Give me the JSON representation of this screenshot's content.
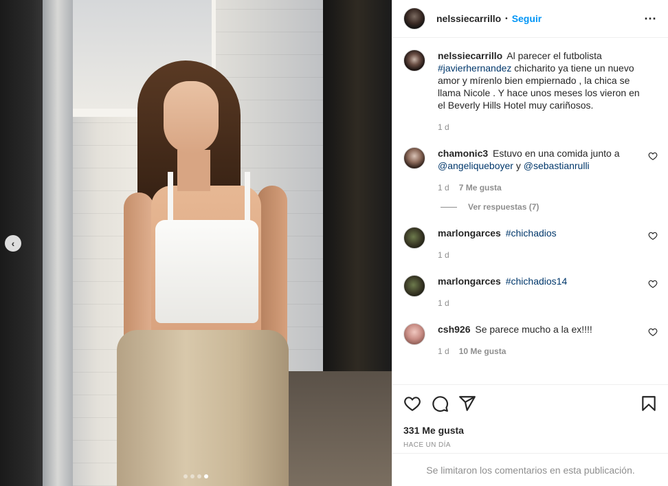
{
  "post": {
    "username": "nelssiecarrillo",
    "separator": "•",
    "follow_label": "Seguir",
    "more_icon": "⋯",
    "image_count": 4,
    "active_image_index": 3
  },
  "caption": {
    "user": "nelssiecarrillo",
    "text_before": "Al parecer el futbolista ",
    "hashtag": "#javierhernandez",
    "text_after": " chicharito ya tiene un nuevo amor y mírenlo bien empiernado , la chica se llama Nicole . Y hace unos meses los vieron en el Beverly Hills Hotel muy cariñosos.",
    "time": "1 d"
  },
  "comments": [
    {
      "user": "chamonic3",
      "text_before": "Estuvo en una comida junto a ",
      "mention1": "@angeliqueboyer",
      "text_mid": " y ",
      "mention2": "@sebastianrulli",
      "time": "1 d",
      "likes": "7 Me gusta",
      "replies": "Ver respuestas (7)"
    },
    {
      "user": "marlongarces",
      "tag": "#chichadios",
      "time": "1 d"
    },
    {
      "user": "marlongarces",
      "tag": "#chichadios14",
      "time": "1 d"
    },
    {
      "user": "csh926",
      "text": "Se parece mucho a la ex!!!!",
      "time": "1 d",
      "likes": "10 Me gusta"
    }
  ],
  "actions": {
    "like_icon": "heart-icon",
    "comment_icon": "comment-icon",
    "share_icon": "paper-plane-icon",
    "save_icon": "bookmark-icon",
    "likes_total": "331 Me gusta",
    "timestamp": "Hace un día"
  },
  "footer": {
    "text": "Se limitaron los comentarios en esta publicación."
  },
  "colors": {
    "link": "#0095f6",
    "tag": "#00376b",
    "muted": "#8e8e8e",
    "text": "#262626"
  }
}
